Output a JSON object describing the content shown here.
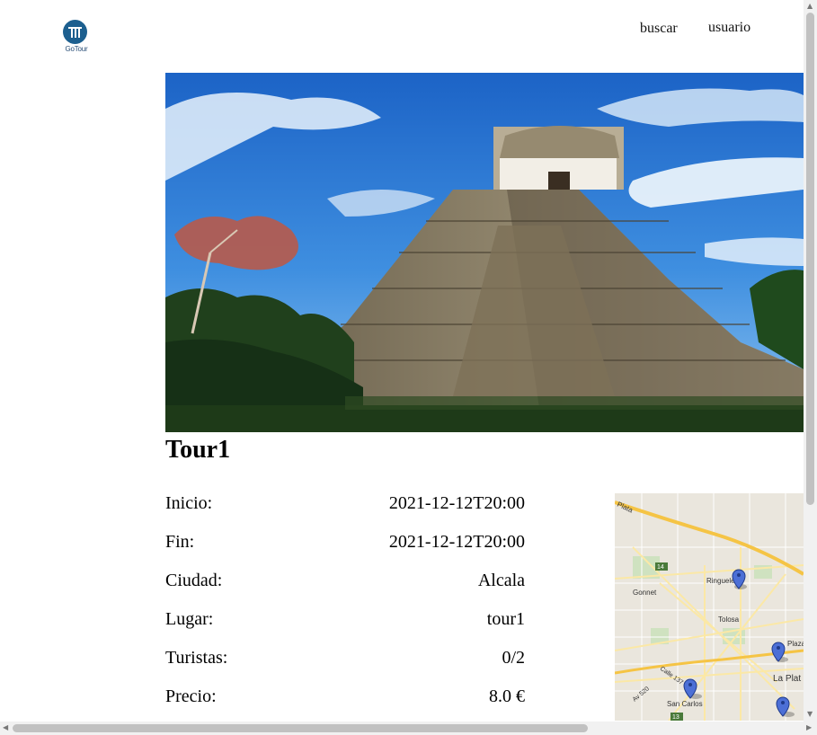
{
  "header": {
    "logo_text": "GoTour",
    "nav": {
      "search_label": "buscar",
      "user_label": "usuario"
    }
  },
  "tour": {
    "title": "Tour1",
    "details": [
      {
        "label": "Inicio:",
        "value": "2021-12-12T20:00"
      },
      {
        "label": "Fin:",
        "value": "2021-12-12T20:00"
      },
      {
        "label": "Ciudad:",
        "value": "Alcala"
      },
      {
        "label": "Lugar:",
        "value": "tour1"
      },
      {
        "label": "Turistas:",
        "value": "0/2"
      },
      {
        "label": "Precio:",
        "value": "8.0 €"
      }
    ]
  },
  "map": {
    "labels": [
      "Plata",
      "Ringuelet",
      "Gonnet",
      "Tolosa",
      "Plaza Mo",
      "La Plat",
      "San Carlos",
      "Calle 137",
      "Av 520",
      "14",
      "13"
    ]
  },
  "colors": {
    "logo": "#1c5f8f",
    "marker": "#4c6fd6",
    "road_major": "#f5c445",
    "road_minor": "#fbe8a6"
  }
}
